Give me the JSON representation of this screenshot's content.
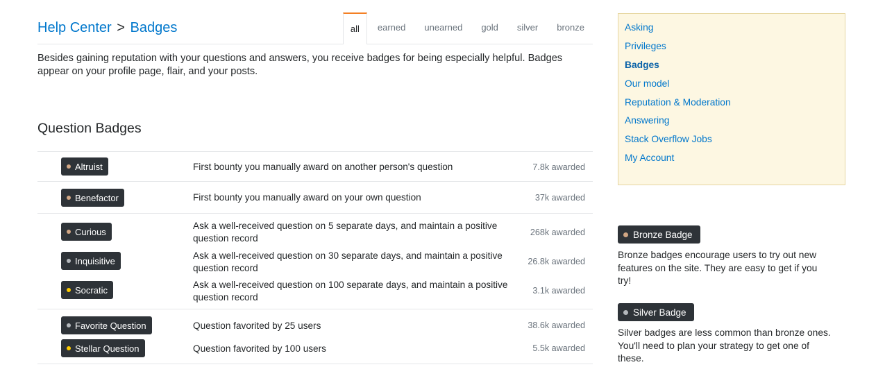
{
  "breadcrumb": {
    "root": "Help Center",
    "separator": ">",
    "current": "Badges"
  },
  "tabs": [
    {
      "label": "all",
      "active": true
    },
    {
      "label": "earned",
      "active": false
    },
    {
      "label": "unearned",
      "active": false
    },
    {
      "label": "gold",
      "active": false
    },
    {
      "label": "silver",
      "active": false
    },
    {
      "label": "bronze",
      "active": false
    }
  ],
  "intro": "Besides gaining reputation with your questions and answers, you receive badges for being especially helpful. Badges appear on your profile page, flair, and your posts.",
  "section_title": "Question Badges",
  "badge_colors": {
    "bronze": "#d1a684",
    "silver": "#b4b8bc",
    "gold": "#ffcc01",
    "badge_bg": "#2e3338",
    "link": "#0077cc",
    "tab_accent": "#f48024",
    "sidebar_bg": "#fdf7e2"
  },
  "badge_rows": [
    {
      "name": "Altruist",
      "tier": "bronze",
      "description": "First bounty you manually award on another person's question",
      "awarded": "7.8k awarded"
    },
    {
      "name": "Benefactor",
      "tier": "bronze",
      "description": "First bounty you manually award on your own question",
      "awarded": "37k awarded"
    },
    {
      "name": "Curious",
      "tier": "bronze",
      "description": "Ask a well-received question on 5 separate days, and maintain a positive question record",
      "awarded": "268k awarded"
    },
    {
      "name": "Inquisitive",
      "tier": "silver",
      "description": "Ask a well-received question on 30 separate days, and maintain a positive question record",
      "awarded": "26.8k awarded"
    },
    {
      "name": "Socratic",
      "tier": "gold",
      "description": "Ask a well-received question on 100 separate days, and maintain a positive question record",
      "awarded": "3.1k awarded"
    },
    {
      "name": "Favorite Question",
      "tier": "silver",
      "description": "Question favorited by 25 users",
      "awarded": "38.6k awarded"
    },
    {
      "name": "Stellar Question",
      "tier": "gold",
      "description": "Question favorited by 100 users",
      "awarded": "5.5k awarded"
    }
  ],
  "sidebar": {
    "links": [
      {
        "label": "Asking",
        "current": false
      },
      {
        "label": "Privileges",
        "current": false
      },
      {
        "label": "Badges",
        "current": true
      },
      {
        "label": "Our model",
        "current": false
      },
      {
        "label": "Reputation & Moderation",
        "current": false
      },
      {
        "label": "Answering",
        "current": false
      },
      {
        "label": "Stack Overflow Jobs",
        "current": false
      },
      {
        "label": "My Account",
        "current": false
      }
    ]
  },
  "legend": [
    {
      "badge": "Bronze Badge",
      "tier": "bronze",
      "text": "Bronze badges encourage users to try out new features on the site. They are easy to get if you try!"
    },
    {
      "badge": "Silver Badge",
      "tier": "silver",
      "text": "Silver badges are less common than bronze ones. You'll need to plan your strategy to get one of these."
    }
  ]
}
